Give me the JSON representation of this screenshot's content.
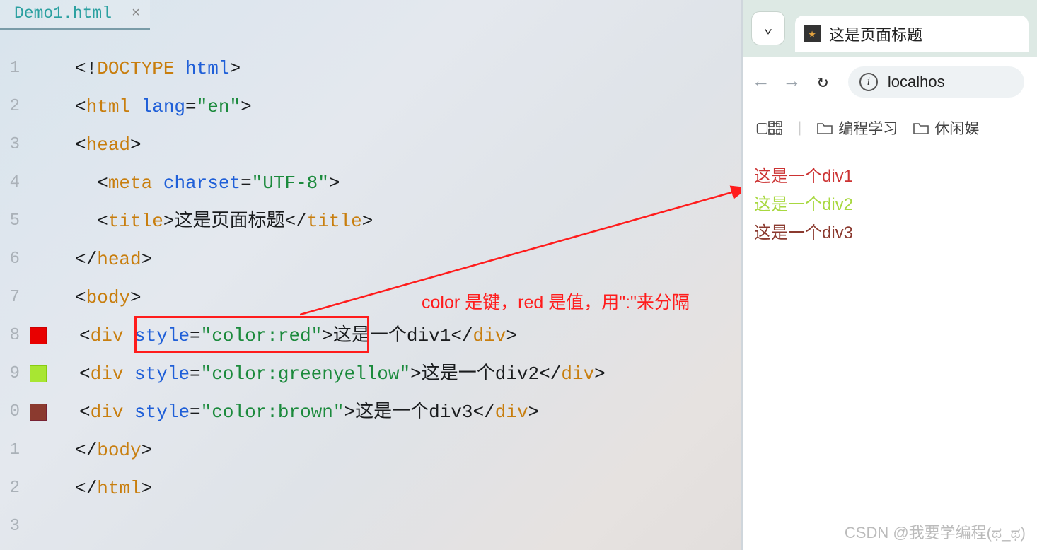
{
  "tab": {
    "filename": "Demo1.html"
  },
  "code": {
    "lines": [
      {
        "n": "1",
        "indent": "",
        "tokens": [
          [
            "punct",
            "<!"
          ],
          [
            "tag",
            "DOCTYPE "
          ],
          [
            "attr",
            "html"
          ],
          [
            "punct",
            ">"
          ]
        ]
      },
      {
        "n": "2",
        "indent": "",
        "tokens": [
          [
            "punct",
            "<"
          ],
          [
            "tag",
            "html "
          ],
          [
            "attr",
            "lang"
          ],
          [
            "punct",
            "="
          ],
          [
            "val",
            "\"en\""
          ],
          [
            "punct",
            ">"
          ]
        ]
      },
      {
        "n": "3",
        "indent": "",
        "tokens": [
          [
            "punct",
            "<"
          ],
          [
            "tag",
            "head"
          ],
          [
            "punct",
            ">"
          ]
        ]
      },
      {
        "n": "4",
        "indent": "  ",
        "tokens": [
          [
            "punct",
            "<"
          ],
          [
            "tag",
            "meta "
          ],
          [
            "attr",
            "charset"
          ],
          [
            "punct",
            "="
          ],
          [
            "val",
            "\"UTF-8\""
          ],
          [
            "punct",
            ">"
          ]
        ]
      },
      {
        "n": "5",
        "indent": "  ",
        "tokens": [
          [
            "punct",
            "<"
          ],
          [
            "tag",
            "title"
          ],
          [
            "punct",
            ">"
          ],
          [
            "txt",
            "这是页面标题"
          ],
          [
            "punct",
            "</"
          ],
          [
            "tag",
            "title"
          ],
          [
            "punct",
            ">"
          ]
        ]
      },
      {
        "n": "6",
        "indent": "",
        "tokens": [
          [
            "punct",
            "</"
          ],
          [
            "tag",
            "head"
          ],
          [
            "punct",
            ">"
          ]
        ]
      },
      {
        "n": "7",
        "indent": "",
        "tokens": [
          [
            "punct",
            "<"
          ],
          [
            "tag",
            "body"
          ],
          [
            "punct",
            ">"
          ]
        ]
      },
      {
        "n": "8",
        "indent": "",
        "swatch": "red",
        "tokens": [
          [
            "punct",
            "<"
          ],
          [
            "tag",
            "div "
          ],
          [
            "attr",
            "style"
          ],
          [
            "punct",
            "="
          ],
          [
            "val",
            "\"color:red\""
          ],
          [
            "punct",
            ">"
          ],
          [
            "txt",
            "这是一个div1"
          ],
          [
            "punct",
            "</"
          ],
          [
            "tag",
            "div"
          ],
          [
            "punct",
            ">"
          ]
        ]
      },
      {
        "n": "9",
        "indent": "",
        "swatch": "green",
        "tokens": [
          [
            "punct",
            "<"
          ],
          [
            "tag",
            "div "
          ],
          [
            "attr",
            "style"
          ],
          [
            "punct",
            "="
          ],
          [
            "val",
            "\"color:greenyellow\""
          ],
          [
            "punct",
            ">"
          ],
          [
            "txt",
            "这是一个div2"
          ],
          [
            "punct",
            "</"
          ],
          [
            "tag",
            "div"
          ],
          [
            "punct",
            ">"
          ]
        ]
      },
      {
        "n": "0",
        "indent": "",
        "swatch": "brown",
        "tokens": [
          [
            "punct",
            "<"
          ],
          [
            "tag",
            "div "
          ],
          [
            "attr",
            "style"
          ],
          [
            "punct",
            "="
          ],
          [
            "val",
            "\"color:brown\""
          ],
          [
            "punct",
            ">"
          ],
          [
            "txt",
            "这是一个div3"
          ],
          [
            "punct",
            "</"
          ],
          [
            "tag",
            "div"
          ],
          [
            "punct",
            ">"
          ]
        ]
      },
      {
        "n": "1",
        "indent": "",
        "tokens": [
          [
            "punct",
            "</"
          ],
          [
            "tag",
            "body"
          ],
          [
            "punct",
            ">"
          ]
        ]
      },
      {
        "n": "2",
        "indent": "",
        "tokens": [
          [
            "punct",
            "</"
          ],
          [
            "tag",
            "html"
          ],
          [
            "punct",
            ">"
          ]
        ]
      },
      {
        "n": "3",
        "indent": "",
        "tokens": []
      }
    ]
  },
  "annotation": "color 是键，red 是值，用\":\"来分隔",
  "browser": {
    "page_title": "这是页面标题",
    "url": "localhos",
    "bookmarks": {
      "folder1": "编程学习",
      "folder2": "休闲娱"
    },
    "output": {
      "div1": "这是一个div1",
      "div2": "这是一个div2",
      "div3": "这是一个div3"
    }
  },
  "watermark": "CSDN @我要学编程(ಥ_ಥ)"
}
